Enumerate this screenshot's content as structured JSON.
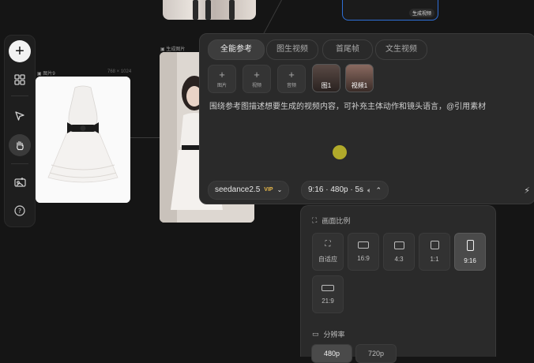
{
  "canvas": {
    "ref_node_label": "图片9",
    "ref_node_dims": "768 × 1024",
    "gen_node_label": "生成图片",
    "top_video_tag": "生成视频"
  },
  "toolbar": {
    "items": [
      {
        "name": "add",
        "icon": "plus-icon"
      },
      {
        "name": "layout",
        "icon": "grid-icon"
      },
      {
        "name": "select",
        "icon": "cursor-icon"
      },
      {
        "name": "pan",
        "icon": "hand-icon"
      },
      {
        "name": "upload",
        "icon": "image-upload-icon"
      },
      {
        "name": "help",
        "icon": "help-icon"
      }
    ]
  },
  "panel": {
    "tabs": [
      {
        "label": "全能参考",
        "active": true
      },
      {
        "label": "图生视频",
        "active": false
      },
      {
        "label": "首尾帧",
        "active": false
      },
      {
        "label": "文生视频",
        "active": false
      }
    ],
    "upload_buttons": [
      "图片",
      "视频",
      "音频"
    ],
    "references": [
      {
        "label": "图1"
      },
      {
        "label": "视频1"
      }
    ],
    "prompt_placeholder": "围绕参考图描述想要生成的视频内容，可补充主体动作和镜头语言，@引用素材",
    "model": "seedance2.5",
    "model_badge": "VIP",
    "settings_summary": "9:16 · 480p · 5s"
  },
  "dropdown": {
    "ratio_title": "画面比例",
    "ratios": [
      {
        "label": "自适应",
        "active": false
      },
      {
        "label": "16:9",
        "active": false
      },
      {
        "label": "4:3",
        "active": false
      },
      {
        "label": "1:1",
        "active": false
      },
      {
        "label": "9:16",
        "active": true
      },
      {
        "label": "21:9",
        "active": false
      }
    ],
    "resolution_title": "分辨率",
    "resolutions": [
      {
        "label": "480p",
        "active": true
      },
      {
        "label": "720p",
        "active": false
      }
    ]
  },
  "colors": {
    "background": "#151515",
    "panel": "#2a2a2a",
    "accent_blue": "#2f6fd6",
    "vip_gold": "#e6b84a",
    "cursor_yellow": "#c9c12a"
  }
}
